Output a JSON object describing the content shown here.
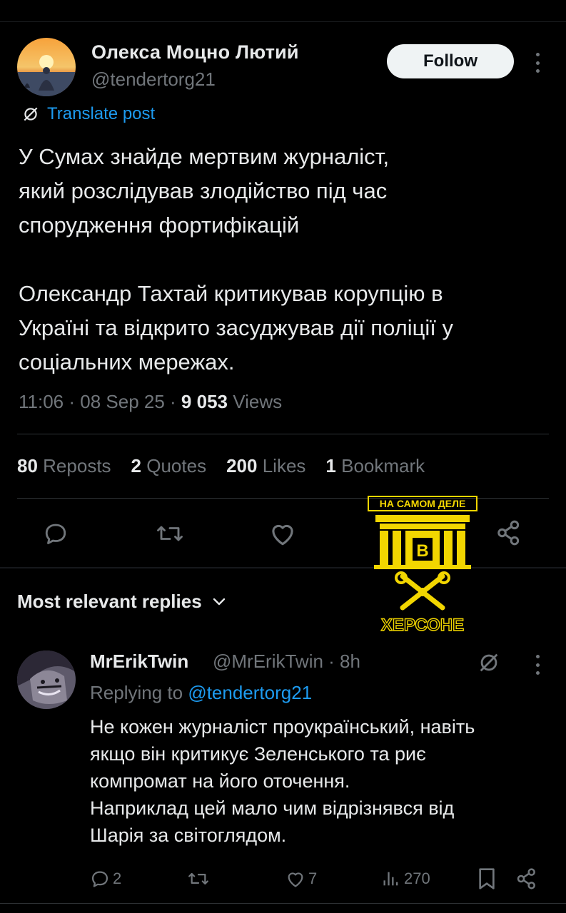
{
  "post": {
    "author_name": "Олекса Моцно Лютий",
    "author_handle": "@tendertorg21",
    "follow_label": "Follow",
    "translate_label": "Translate post",
    "text_paragraph_1": "У Сумах знайде мертвим журналіст,\nякий розслідував злодійство під час\nспорудження фортифікацій",
    "text_paragraph_2": "Олександр Тахтай критикував корупцію в\nУкраїні та відкрито засуджував дії поліції у\nсоціальних мережах.",
    "time": "11:06",
    "date": "08 Sep 25",
    "views_count": "9 053",
    "views_label": "Views",
    "stats": {
      "reposts_count": "80",
      "reposts_label": "Reposts",
      "quotes_count": "2",
      "quotes_label": "Quotes",
      "likes_count": "200",
      "likes_label": "Likes",
      "bookmarks_count": "1",
      "bookmarks_label": "Bookmark"
    },
    "icons": [
      "reply-icon",
      "repost-icon",
      "like-icon",
      "bookmark-icon",
      "share-icon"
    ]
  },
  "watermark": {
    "top_text": "НА САМОМ ДЕЛЕ",
    "letter": "В",
    "bottom_text": "ХЕРСОНЕ",
    "color": "#f2d600"
  },
  "replies_section": {
    "label": "Most relevant replies"
  },
  "reply": {
    "author_name": "MrErikTwin",
    "author_handle": "@MrErikTwin · 8h",
    "replying_prefix": "Replying to",
    "replying_to": "@tendertorg21",
    "text": "Не кожен журналіст проукраїнський, навіть\nякщо він критикує Зеленського та риє\nкомпромат на його оточення.\nНаприклад цей мало чим відрізнявся від\nШарія за світоглядом.",
    "replies_count": "2",
    "likes_count": "7",
    "views_count": "270"
  },
  "colors": {
    "background": "#000000",
    "text_primary": "#e7e9ea",
    "text_secondary": "#71767b",
    "accent": "#1d9bf0",
    "divider": "#2f3336"
  }
}
